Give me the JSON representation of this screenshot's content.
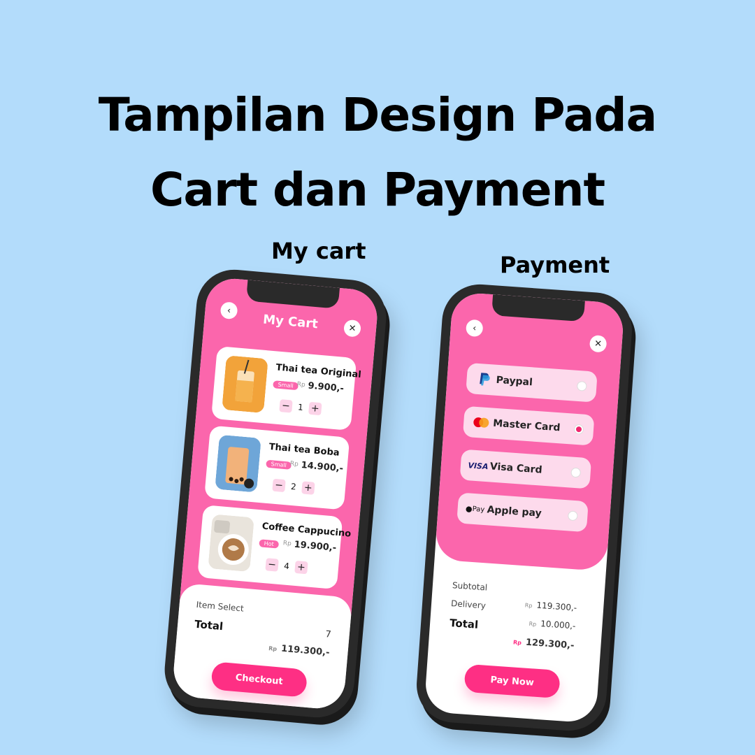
{
  "headline": {
    "line1": "Tampilan Design Pada",
    "line2": "Cart dan Payment"
  },
  "labels": {
    "cart_phone": "My cart",
    "payment_phone": "Payment"
  },
  "colors": {
    "background": "#b3dcfb",
    "accent_pink": "#fb66ac",
    "button_pink": "#fe2f84",
    "light_pink": "#fddaec"
  },
  "cart": {
    "title": "My Cart",
    "back_icon": "chevron-left-icon",
    "close_icon": "close-icon",
    "items": [
      {
        "name": "Thai tea Original",
        "size": "Small",
        "currency": "Rp",
        "price": "9.900,-",
        "qty": "1"
      },
      {
        "name": "Thai tea Boba",
        "size": "Small",
        "currency": "Rp",
        "price": "14.900,-",
        "qty": "2"
      },
      {
        "name": "Coffee Cappucino",
        "size": "Hot",
        "currency": "Rp",
        "price": "19.900,-",
        "qty": "4"
      }
    ],
    "minus": "−",
    "plus": "+",
    "summary": {
      "item_select_label": "Item Select",
      "item_select_value": "7",
      "total_label": "Total",
      "total_currency": "Rp",
      "total_value": "119.300,-"
    },
    "checkout_label": "Checkout"
  },
  "payment": {
    "back_icon": "chevron-left-icon",
    "close_icon": "close-icon",
    "methods": [
      {
        "label": "Paypal",
        "icon": "paypal-icon",
        "selected": false
      },
      {
        "label": "Master Card",
        "icon": "mastercard-icon",
        "selected": true
      },
      {
        "label": "Visa Card",
        "icon": "visa-icon",
        "selected": false
      },
      {
        "label": "Apple pay",
        "icon": "apple-pay-icon",
        "selected": false
      }
    ],
    "visa_text": "VISA",
    "applepay_text": "Pay",
    "summary": {
      "subtotal_label": "Subtotal",
      "delivery_label": "Delivery",
      "total_label": "Total",
      "currency": "Rp",
      "subtotal_value": "119.300,-",
      "delivery_value": "10.000,-",
      "total_value": "129.300,-"
    },
    "pay_label": "Pay Now"
  }
}
